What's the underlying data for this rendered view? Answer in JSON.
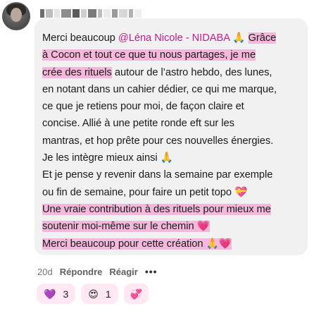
{
  "comment": {
    "lines": [
      {
        "plain_before": "Merci beaucoup ",
        "mention": "@Léna Nicole - NIDABA",
        "plain_mid": " 🙏 ",
        "hl": "Grâce"
      },
      {
        "hl": "à Cocon et tout ce que tu nous partages, je me"
      },
      {
        "hl": "crée des rituels",
        "plain_after": " autour de l’astro hebdo, des lunes,"
      },
      {
        "plain": "en notant dans un cahier dédier, ce qui me marque,"
      },
      {
        "plain": "ce que je retiens pour moi, de façon claire et"
      },
      {
        "plain": "concise. Allié à une petite ronde eft sur les"
      },
      {
        "plain": "mantras, et hop prête pour ces nouvelles énergies."
      },
      {
        "plain": "Je les intègre mieux ainsi 🙏"
      },
      {
        "plain": "Et je pense y revenir dans la semaine par exemple"
      },
      {
        "plain": "ou fin de semaine, pour faire un petit topo 💝"
      },
      {
        "hl": "Une vraie contribution à des rituels pour mieux me"
      },
      {
        "hl": "soutenir moi-même sur le chemin 💗"
      },
      {
        "hl": "Merci beaucoup pour cette création 🙏💗"
      }
    ]
  },
  "actions": {
    "time": "20d",
    "reply": "Répondre",
    "react": "Réagir",
    "more": "•••"
  },
  "reactions": [
    {
      "icon": "💜",
      "icon_name": "purple-heart-icon",
      "count": "3"
    },
    {
      "icon": "😍",
      "icon_name": "heart-eyes-icon",
      "count": "1"
    }
  ],
  "add_reaction_icon": "💞",
  "colors": {
    "highlight": "#f5b8dc",
    "mention": "#c01f8c",
    "bubble": "#f1f1f2",
    "reaction_pill": "#ffe8f4"
  }
}
